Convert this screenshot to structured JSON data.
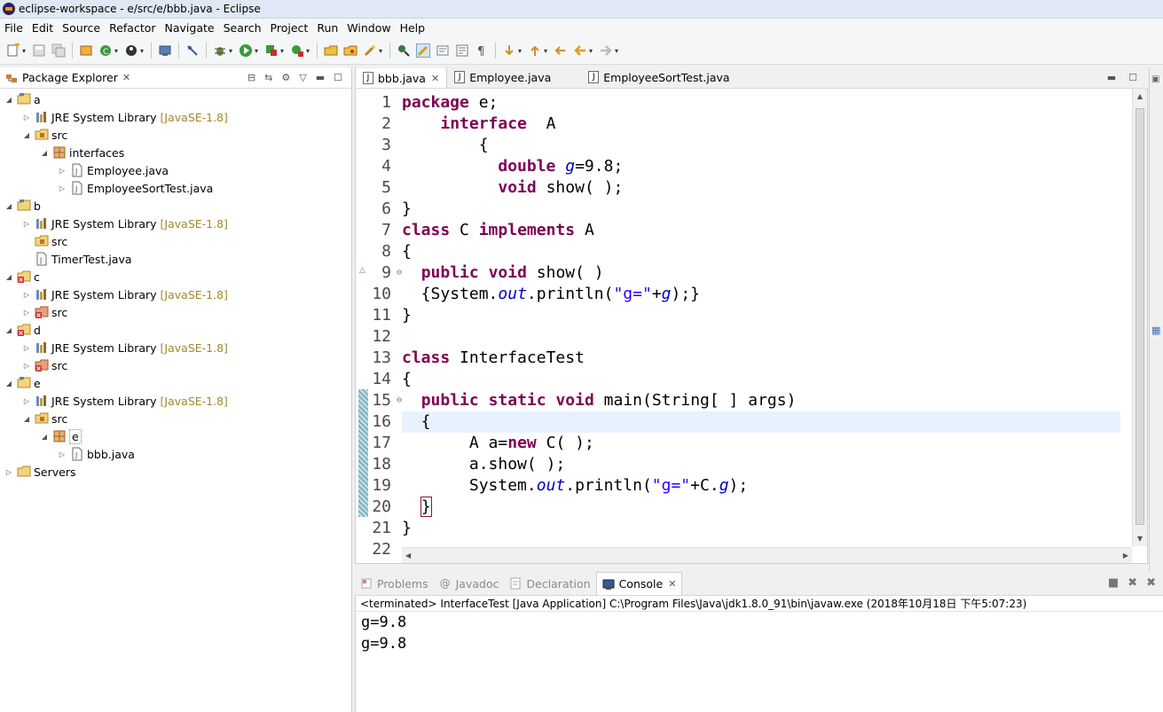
{
  "window": {
    "title": "eclipse-workspace - e/src/e/bbb.java - Eclipse"
  },
  "menu": [
    "File",
    "Edit",
    "Source",
    "Refactor",
    "Navigate",
    "Search",
    "Project",
    "Run",
    "Window",
    "Help"
  ],
  "package_explorer": {
    "title": "Package Explorer",
    "tree": [
      {
        "label": "a",
        "decor": "",
        "icon": "project-icon"
      },
      {
        "label": "JRE System Library",
        "decor": "[JavaSE-1.8]",
        "icon": "library-icon"
      },
      {
        "label": "src",
        "decor": "",
        "icon": "source-folder-icon"
      },
      {
        "label": "interfaces",
        "decor": "",
        "icon": "package-icon"
      },
      {
        "label": "Employee.java",
        "decor": "",
        "icon": "java-file-icon"
      },
      {
        "label": "EmployeeSortTest.java",
        "decor": "",
        "icon": "java-file-icon"
      },
      {
        "label": "b",
        "decor": "",
        "icon": "project-icon"
      },
      {
        "label": "JRE System Library",
        "decor": "[JavaSE-1.8]",
        "icon": "library-icon"
      },
      {
        "label": "src",
        "decor": "",
        "icon": "source-folder-icon"
      },
      {
        "label": "TimerTest.java",
        "decor": "",
        "icon": "java-file-icon"
      },
      {
        "label": "c",
        "decor": "",
        "icon": "project-error-icon"
      },
      {
        "label": "JRE System Library",
        "decor": "[JavaSE-1.8]",
        "icon": "library-icon"
      },
      {
        "label": "src",
        "decor": "",
        "icon": "source-folder-error-icon"
      },
      {
        "label": "d",
        "decor": "",
        "icon": "project-error-icon"
      },
      {
        "label": "JRE System Library",
        "decor": "[JavaSE-1.8]",
        "icon": "library-icon"
      },
      {
        "label": "src",
        "decor": "",
        "icon": "source-folder-error-icon"
      },
      {
        "label": "e",
        "decor": "",
        "icon": "project-icon"
      },
      {
        "label": "JRE System Library",
        "decor": "[JavaSE-1.8]",
        "icon": "library-icon"
      },
      {
        "label": "src",
        "decor": "",
        "icon": "source-folder-icon"
      },
      {
        "label": "e",
        "decor": "",
        "icon": "package-icon"
      },
      {
        "label": "bbb.java",
        "decor": "",
        "icon": "java-file-icon"
      },
      {
        "label": "Servers",
        "decor": "",
        "icon": "folder-icon"
      }
    ]
  },
  "editor": {
    "tabs": [
      {
        "label": "bbb.java",
        "active": true
      },
      {
        "label": "Employee.java",
        "active": false
      },
      {
        "label": "EmployeeSortTest.java",
        "active": false
      }
    ],
    "line_numbers": [
      "1",
      "2",
      "3",
      "4",
      "5",
      "6",
      "7",
      "8",
      "9",
      "10",
      "11",
      "12",
      "13",
      "14",
      "15",
      "16",
      "17",
      "18",
      "19",
      "20",
      "21",
      "22"
    ],
    "code_lines": [
      "package e;",
      "    interface  A",
      "        {",
      "          double g=9.8;",
      "          void show( );",
      "}",
      "class C implements A",
      "{",
      "  public void show( )",
      "  {System.out.println(\"g=\"+g);}",
      "}",
      "",
      "class InterfaceTest",
      "{",
      "  public static void main(String[ ] args)",
      "  {",
      "       A a=new C( );",
      "       a.show( );",
      "       System.out.println(\"g=\"+C.g);",
      "  }",
      "}",
      ""
    ]
  },
  "bottom_panel": {
    "tabs": [
      {
        "label": "Problems",
        "active": false,
        "icon": "problems-icon"
      },
      {
        "label": "Javadoc",
        "active": false,
        "icon": "javadoc-icon"
      },
      {
        "label": "Declaration",
        "active": false,
        "icon": "declaration-icon"
      },
      {
        "label": "Console",
        "active": true,
        "icon": "console-icon"
      }
    ],
    "console_status": "<terminated> InterfaceTest [Java Application] C:\\Program Files\\Java\\jdk1.8.0_91\\bin\\javaw.exe (2018年10月18日 下午5:07:23)",
    "output": [
      "g=9.8",
      "g=9.8"
    ]
  },
  "colors": {
    "keyword": "#7f0055",
    "string": "#2a00ff",
    "field": "#0000c0",
    "current_line": "#e8f2fe",
    "titlebar": "#dfe8f4"
  }
}
